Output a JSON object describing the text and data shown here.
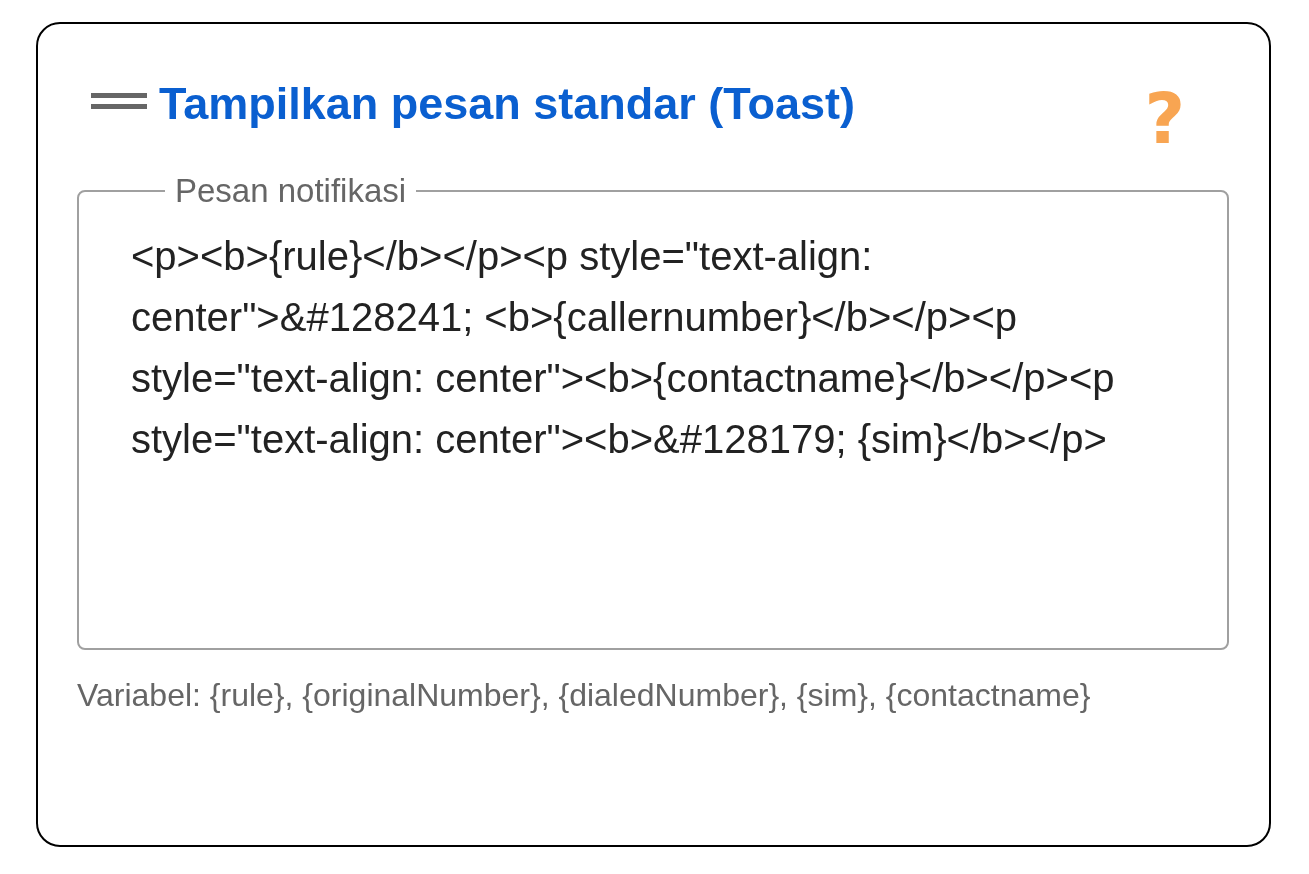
{
  "header": {
    "title": "Tampilkan pesan standar (Toast)",
    "help": "?"
  },
  "field": {
    "label": "Pesan notifikasi",
    "value": "<p><b>{rule}</b></p><p style=\"text-align: center\">&#128241; <b>{callernumber}</b></p><p style=\"text-align: center\"><b>{contactname}</b></p><p style=\"text-align: center\"><b>&#128179; {sim}</b></p>"
  },
  "helper": "Variabel: {rule}, {originalNumber}, {dialedNumber}, {sim}, {contactname}"
}
